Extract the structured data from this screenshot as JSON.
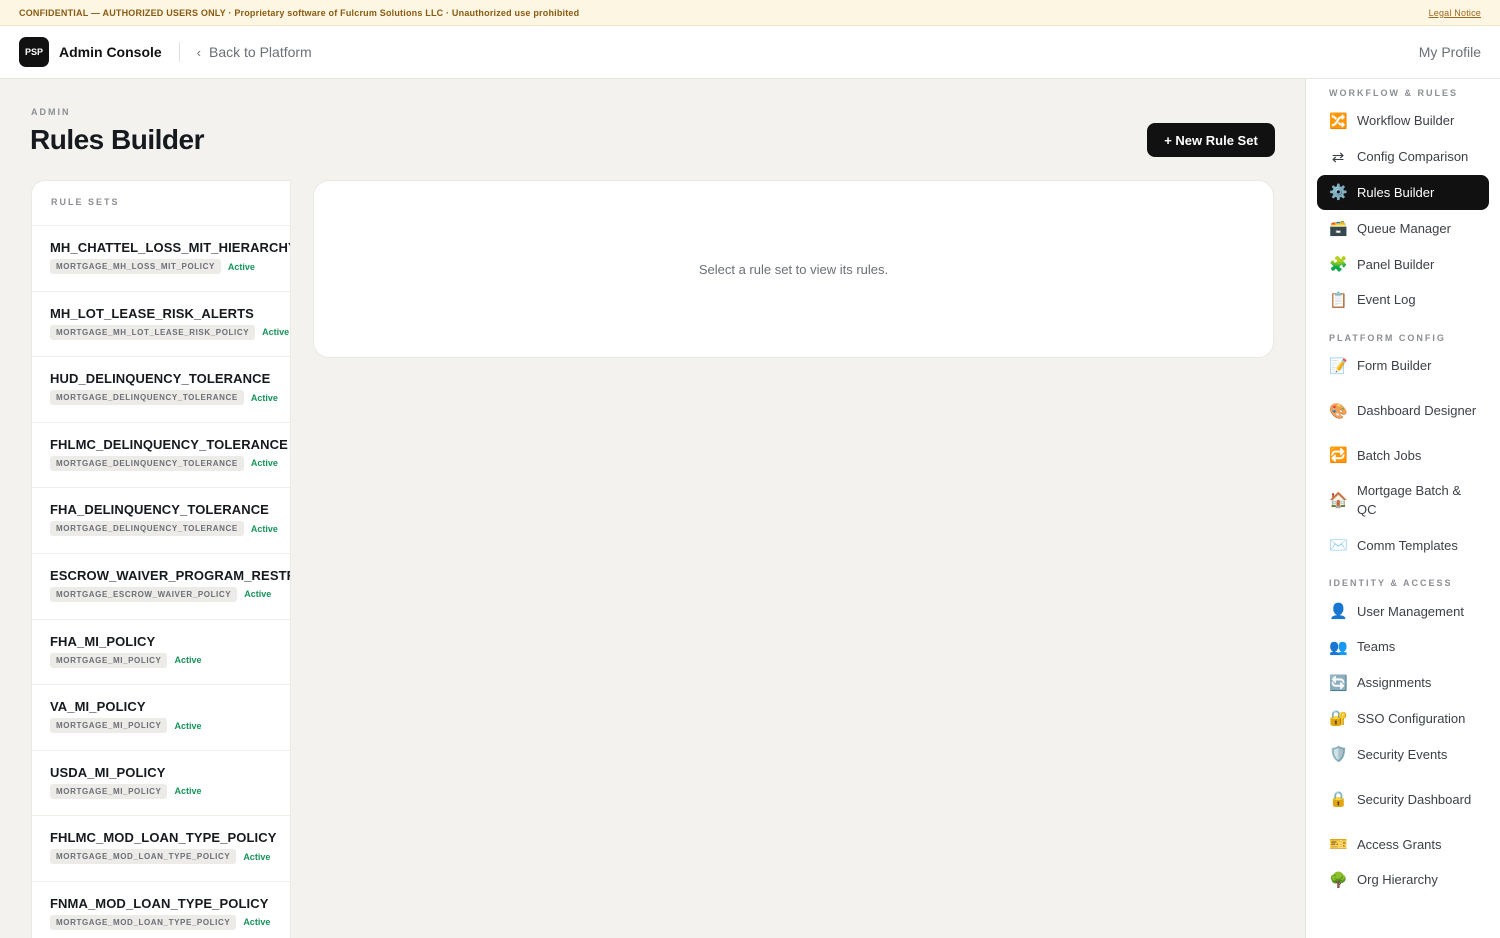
{
  "banner": {
    "text": "CONFIDENTIAL — AUTHORIZED USERS ONLY · Proprietary software of Fulcrum Solutions LLC · Unauthorized use prohibited",
    "link": "Legal Notice"
  },
  "topbar": {
    "logo": "PSP",
    "app_title": "Admin Console",
    "back_label": "Back to Platform",
    "profile_label": "My Profile"
  },
  "page": {
    "eyebrow": "ADMIN",
    "title": "Rules Builder",
    "new_button": "+ New Rule Set"
  },
  "rule_sets": {
    "header": "RULE SETS",
    "items": [
      {
        "name": "MH_CHATTEL_LOSS_MIT_HIERARCHY",
        "tag": "MORTGAGE_MH_LOSS_MIT_POLICY",
        "status": "Active"
      },
      {
        "name": "MH_LOT_LEASE_RISK_ALERTS",
        "tag": "MORTGAGE_MH_LOT_LEASE_RISK_POLICY",
        "status": "Active"
      },
      {
        "name": "HUD_DELINQUENCY_TOLERANCE",
        "tag": "MORTGAGE_DELINQUENCY_TOLERANCE",
        "status": "Active"
      },
      {
        "name": "FHLMC_DELINQUENCY_TOLERANCE",
        "tag": "MORTGAGE_DELINQUENCY_TOLERANCE",
        "status": "Active"
      },
      {
        "name": "FHA_DELINQUENCY_TOLERANCE",
        "tag": "MORTGAGE_DELINQUENCY_TOLERANCE",
        "status": "Active"
      },
      {
        "name": "ESCROW_WAIVER_PROGRAM_RESTRICTIONS",
        "tag": "MORTGAGE_ESCROW_WAIVER_POLICY",
        "status": "Active"
      },
      {
        "name": "FHA_MI_POLICY",
        "tag": "MORTGAGE_MI_POLICY",
        "status": "Active"
      },
      {
        "name": "VA_MI_POLICY",
        "tag": "MORTGAGE_MI_POLICY",
        "status": "Active"
      },
      {
        "name": "USDA_MI_POLICY",
        "tag": "MORTGAGE_MI_POLICY",
        "status": "Active"
      },
      {
        "name": "FHLMC_MOD_LOAN_TYPE_POLICY",
        "tag": "MORTGAGE_MOD_LOAN_TYPE_POLICY",
        "status": "Active"
      },
      {
        "name": "FNMA_MOD_LOAN_TYPE_POLICY",
        "tag": "MORTGAGE_MOD_LOAN_TYPE_POLICY",
        "status": "Active"
      }
    ]
  },
  "detail": {
    "empty_text": "Select a rule set to view its rules."
  },
  "sidebar": {
    "sections": [
      {
        "title": "WORKFLOW & RULES",
        "items": [
          {
            "label": "Workflow Builder",
            "icon": "🔀",
            "icon_name": "shuffle-icon"
          },
          {
            "label": "Config Comparison",
            "icon": "⇄",
            "icon_name": "compare-arrows-icon"
          },
          {
            "label": "Rules Builder",
            "icon": "⚙️",
            "icon_name": "gear-icon",
            "active": true
          },
          {
            "label": "Queue Manager",
            "icon": "🗃️",
            "icon_name": "card-file-box-icon"
          },
          {
            "label": "Panel Builder",
            "icon": "🧩",
            "icon_name": "puzzle-piece-icon"
          },
          {
            "label": "Event Log",
            "icon": "📋",
            "icon_name": "clipboard-icon"
          }
        ]
      },
      {
        "title": "PLATFORM CONFIG",
        "items": [
          {
            "label": "Form Builder",
            "icon": "📝",
            "icon_name": "memo-icon"
          },
          {
            "label": "Dashboard Designer",
            "icon": "🎨",
            "icon_name": "palette-icon"
          },
          {
            "label": "Batch Jobs",
            "icon": "🔁",
            "icon_name": "repeat-icon"
          },
          {
            "label": "Mortgage Batch & QC",
            "icon": "🏠",
            "icon_name": "house-icon"
          },
          {
            "label": "Comm Templates",
            "icon": "✉️",
            "icon_name": "envelope-icon"
          }
        ]
      },
      {
        "title": "IDENTITY & ACCESS",
        "items": [
          {
            "label": "User Management",
            "icon": "👤",
            "icon_name": "user-icon"
          },
          {
            "label": "Teams",
            "icon": "👥",
            "icon_name": "users-icon"
          },
          {
            "label": "Assignments",
            "icon": "🔄",
            "icon_name": "refresh-icon"
          },
          {
            "label": "SSO Configuration",
            "icon": "🔐",
            "icon_name": "lock-key-icon"
          },
          {
            "label": "Security Events",
            "icon": "🛡️",
            "icon_name": "shield-icon"
          },
          {
            "label": "Security Dashboard",
            "icon": "🔒",
            "icon_name": "lock-icon"
          },
          {
            "label": "Access Grants",
            "icon": "🎫",
            "icon_name": "ticket-icon"
          },
          {
            "label": "Org Hierarchy",
            "icon": "🌳",
            "icon_name": "tree-icon"
          }
        ]
      }
    ]
  }
}
